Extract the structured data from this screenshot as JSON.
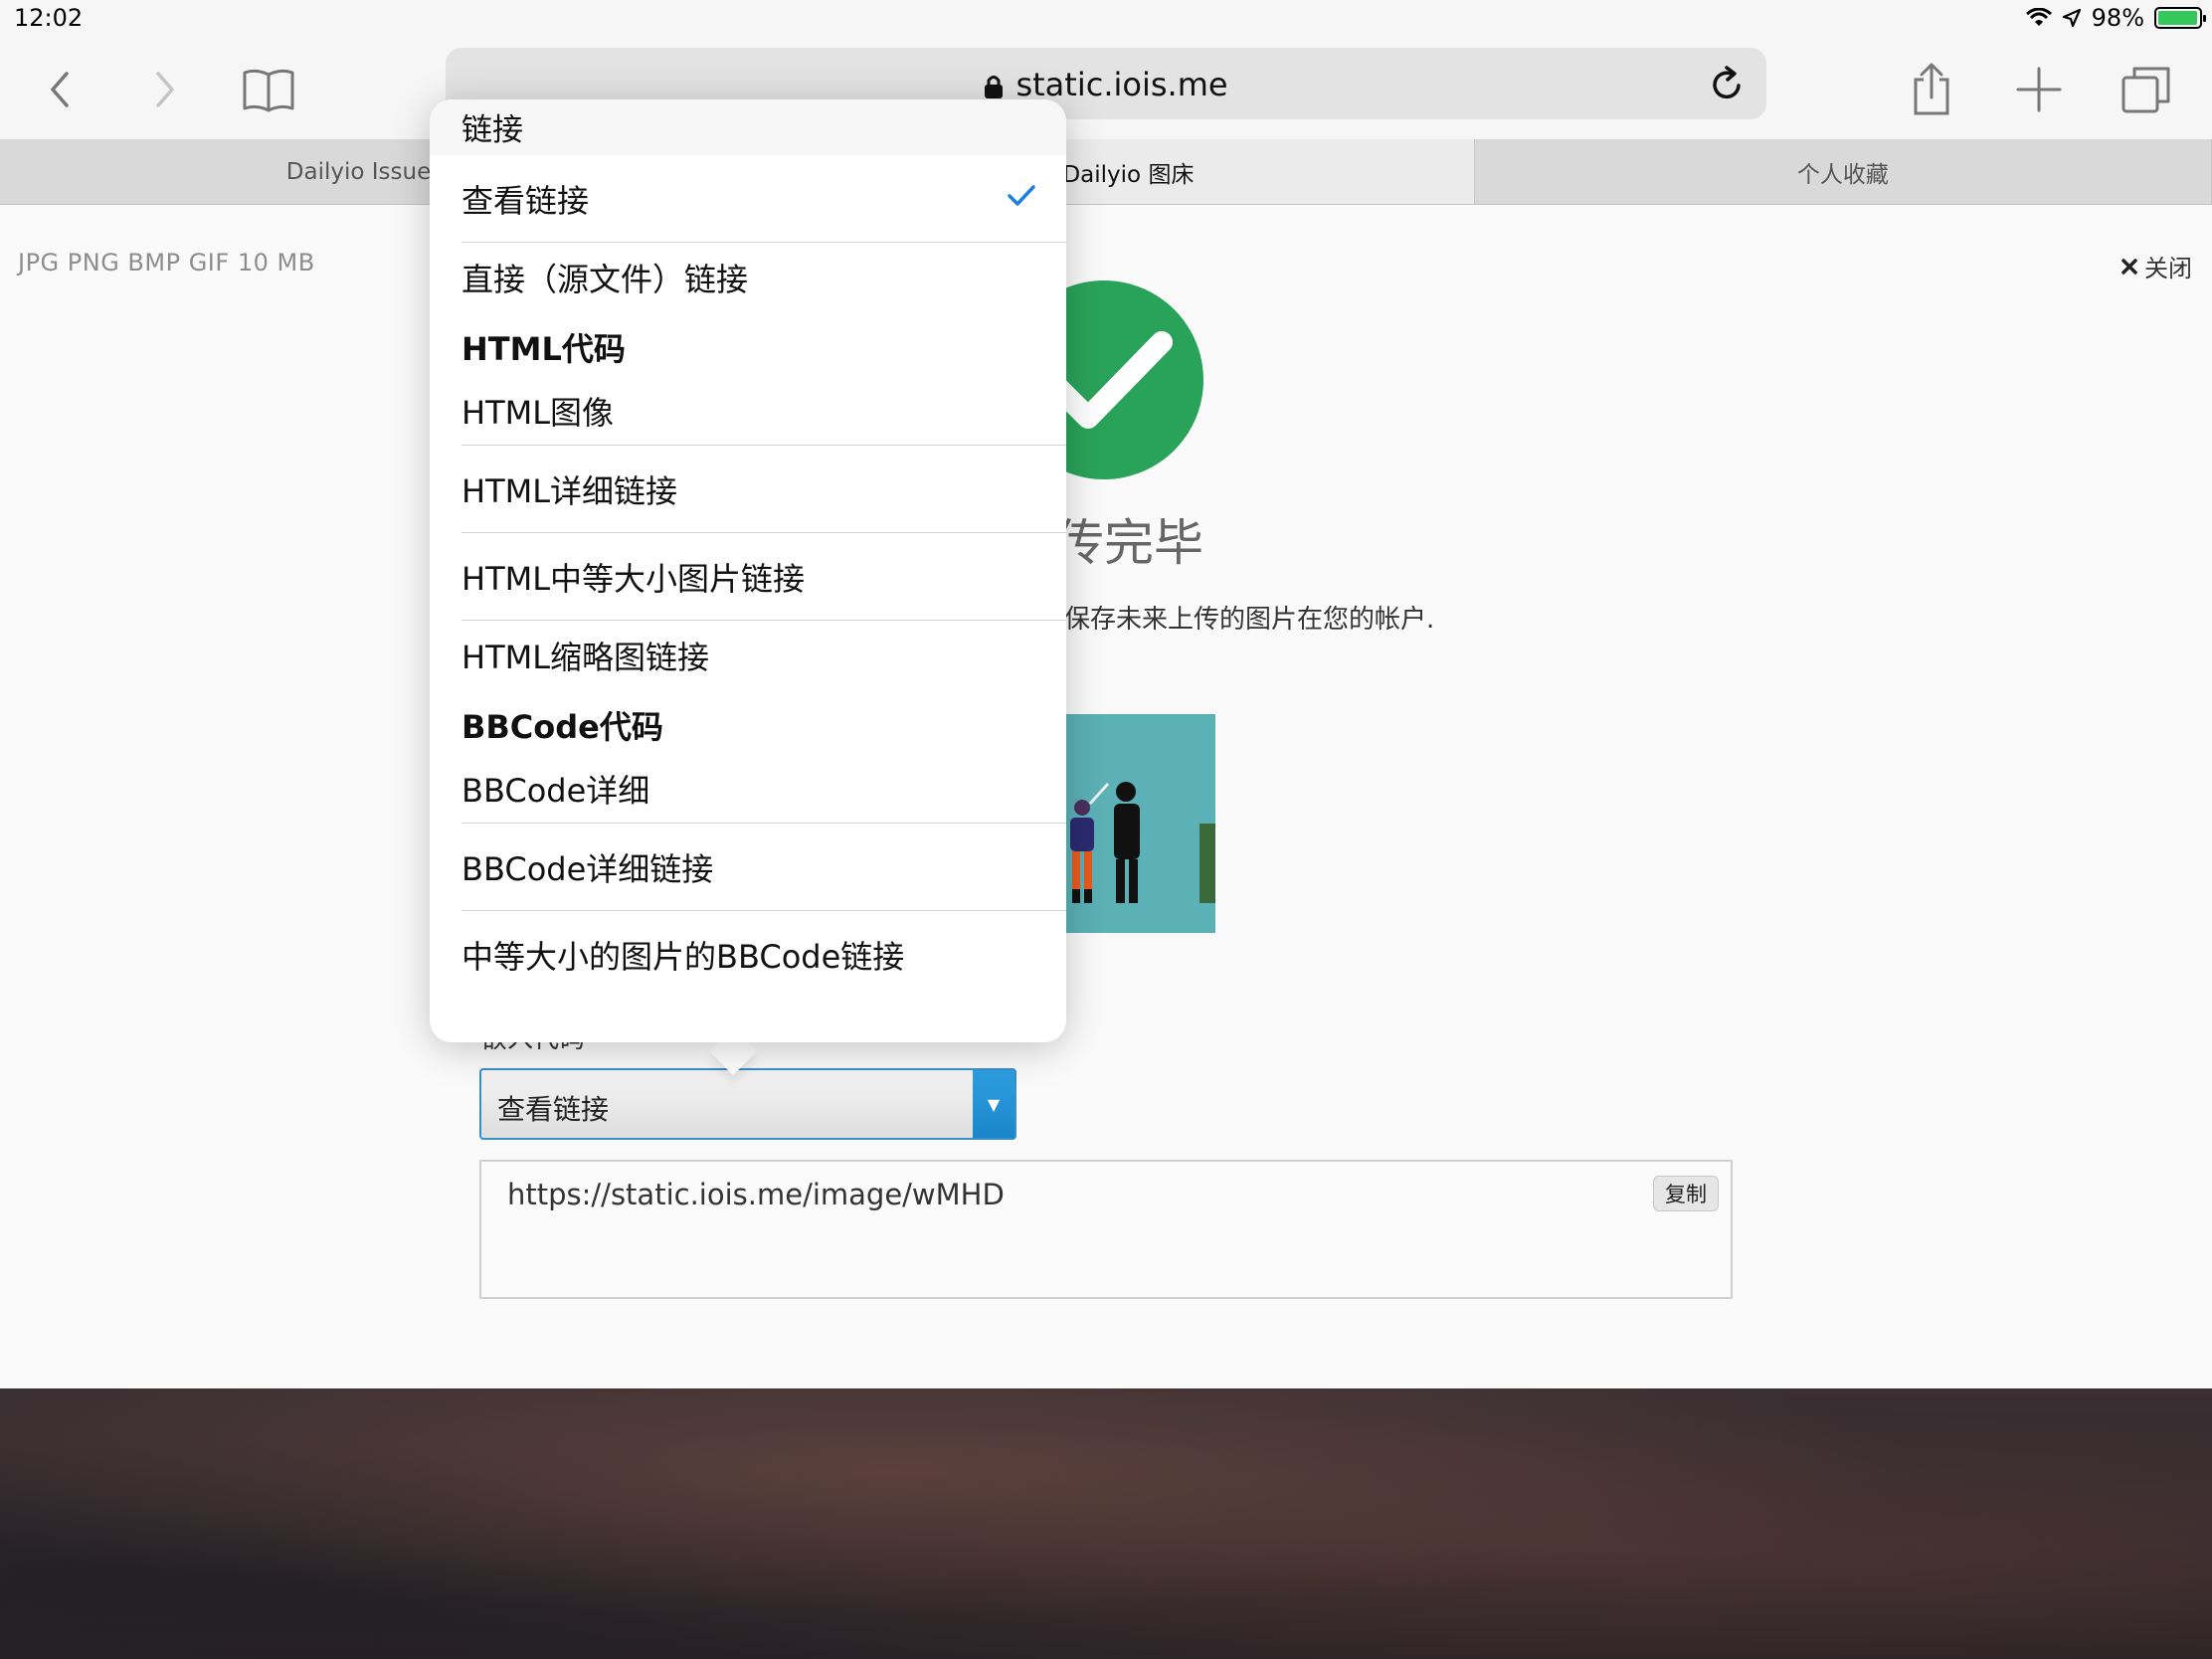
{
  "status_bar": {
    "time": "12:02",
    "battery_percent": "98%",
    "battery_level": 0.98
  },
  "toolbar": {
    "url": "static.iois.me",
    "back_icon": "chevron-left-icon",
    "forward_icon": "chevron-right-icon",
    "bookmarks_icon": "book-icon",
    "reload_icon": "reload-icon",
    "share_icon": "share-icon",
    "new_tab_icon": "plus-icon",
    "tabs_icon": "tabs-icon"
  },
  "tabs": [
    {
      "label": "Dailyio Issue#",
      "active": false
    },
    {
      "label": "床 - Dailyio 图床",
      "active": true
    },
    {
      "label": "个人收藏",
      "active": false
    }
  ],
  "page": {
    "formats": "JPG PNG BMP GIF  10 MB",
    "close_label": "关闭",
    "done_title": "传完毕",
    "done_subtitle": "保存未来上传的图片在您的帐户.",
    "embed_label": "嵌入代码",
    "select_value": "查看链接",
    "code_value": "https://static.iois.me/image/wMHD",
    "copy_label": "复制",
    "accent_color": "#2aa35a",
    "select_accent": "#1a86c9"
  },
  "popover": {
    "header": "链接",
    "link_items": [
      {
        "label": "查看链接",
        "selected": true
      },
      {
        "label": "直接（源文件）链接",
        "selected": false
      }
    ],
    "html_group": "HTML代码",
    "html_items": [
      "HTML图像",
      "HTML详细链接",
      "HTML中等大小图片链接",
      "HTML缩略图链接"
    ],
    "bbcode_group": "BBCode代码",
    "bbcode_items": [
      "BBCode详细",
      "BBCode详细链接",
      "中等大小的图片的BBCode链接"
    ]
  }
}
